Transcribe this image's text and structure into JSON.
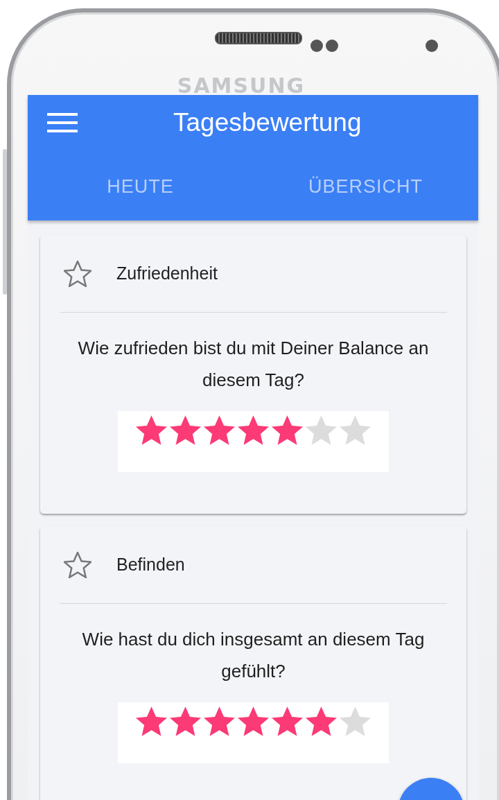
{
  "device": {
    "brand": "SAMSUNG"
  },
  "app_bar": {
    "title": "Tagesbewertung"
  },
  "tabs": [
    {
      "label": "HEUTE",
      "selected": false
    },
    {
      "label": "ÜBERSICHT",
      "selected": false
    }
  ],
  "cards": [
    {
      "title": "Zufriedenheit",
      "question": "Wie zufrieden bist du mit Deiner Balance an diesem Tag?",
      "stars": 5
    },
    {
      "title": "Befinden",
      "question": "Wie hast du dich insgesamt an diesem Tag gefühlt?",
      "stars": 6
    }
  ]
}
